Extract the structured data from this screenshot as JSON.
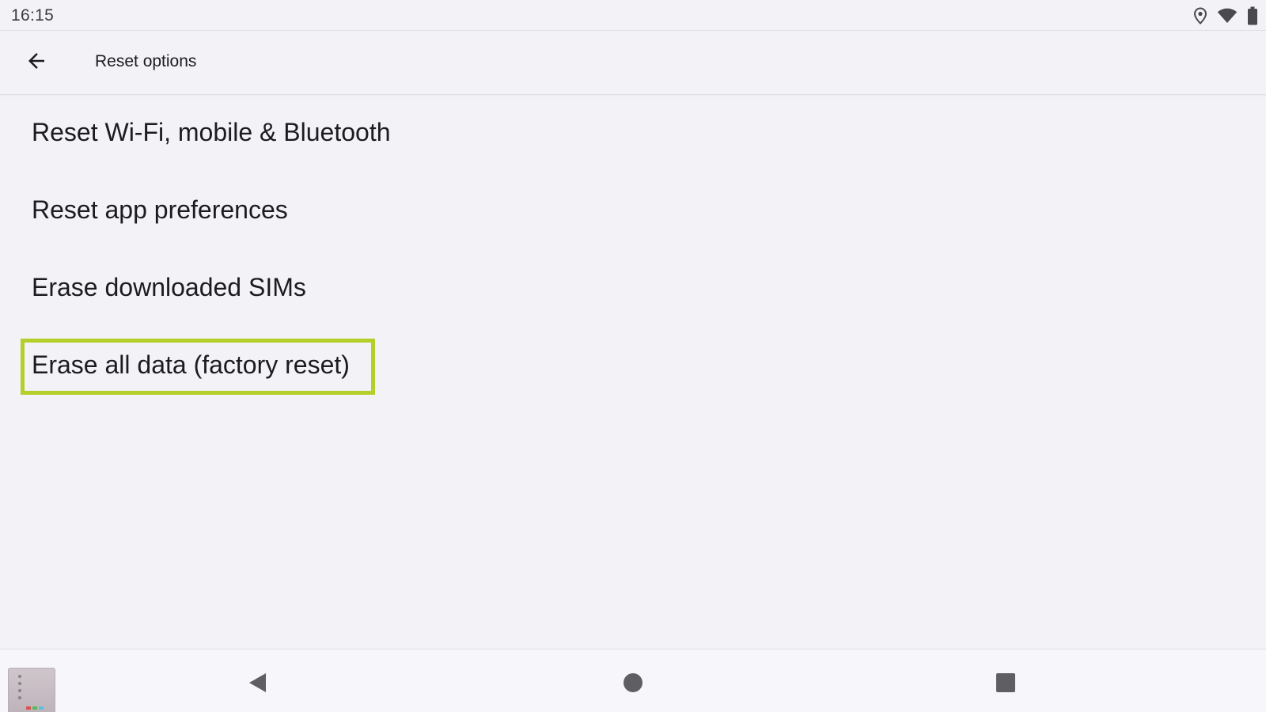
{
  "status_bar": {
    "time": "16:15",
    "icons": [
      "location-icon",
      "wifi-icon",
      "battery-icon"
    ]
  },
  "app_bar": {
    "back_icon": "arrow-back-icon",
    "title": "Reset options"
  },
  "list": {
    "items": [
      {
        "label": "Reset Wi-Fi, mobile & Bluetooth"
      },
      {
        "label": "Reset app preferences"
      },
      {
        "label": "Erase downloaded SIMs"
      },
      {
        "label": "Erase all data (factory reset)",
        "highlighted": true
      }
    ]
  },
  "highlight": {
    "color": "#b5cf2a"
  },
  "nav_bar": {
    "icons": [
      "nav-back-icon",
      "nav-home-icon",
      "nav-recents-icon"
    ]
  },
  "colors": {
    "background": "#f3f2f7",
    "text": "#1c1b1f"
  }
}
